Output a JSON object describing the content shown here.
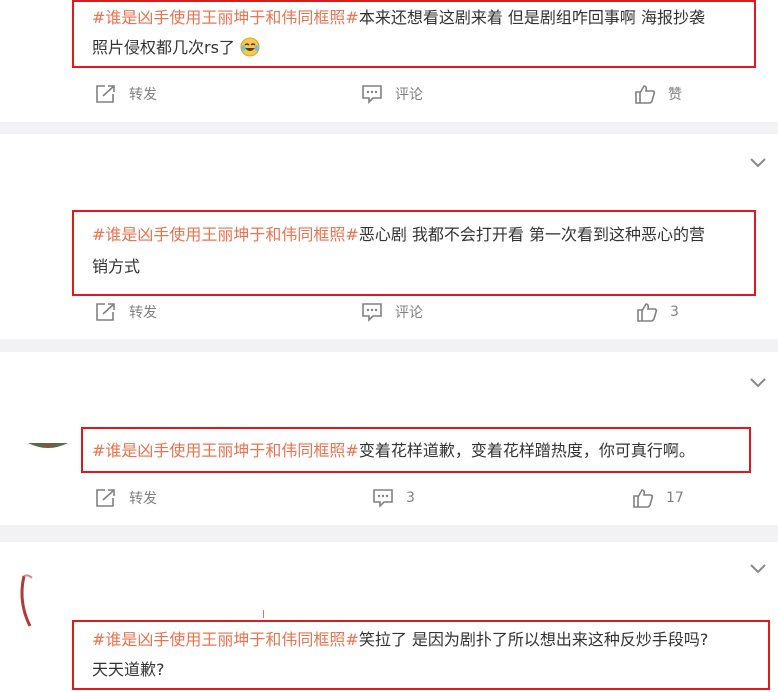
{
  "posts": [
    {
      "tag": "#谁是凶手使用王丽坤于和伟同框照#",
      "line1": "本来还想看这剧来着 但是剧组咋回事啊 海报抄袭",
      "line2": "照片侵权都几次rs了",
      "emoji": "crying-laughing-emoji",
      "repost_label": "转发",
      "comment_label": "评论",
      "like_label": "赞"
    },
    {
      "tag": "#谁是凶手使用王丽坤于和伟同框照#",
      "line1": "恶心剧 我都不会打开看 第一次看到这种恶心的营",
      "line2": "销方式",
      "repost_label": "转发",
      "comment_label": "评论",
      "like_count": "3"
    },
    {
      "tag": "#谁是凶手使用王丽坤于和伟同框照#",
      "line1": "变着花样道歉，变着花样蹭热度，你可真行啊。",
      "repost_label": "转发",
      "comment_count": "3",
      "like_count": "17"
    },
    {
      "tag": "#谁是凶手使用王丽坤于和伟同框照#",
      "line1": "笑拉了 是因为剧扑了所以想出来这种反炒手段吗?",
      "line2": "天天道歉?"
    }
  ],
  "colors": {
    "topic": "#eb7350",
    "highlight_box": "#e0181f",
    "action_gray": "#808080",
    "divider_bg": "#f2f2f5"
  }
}
